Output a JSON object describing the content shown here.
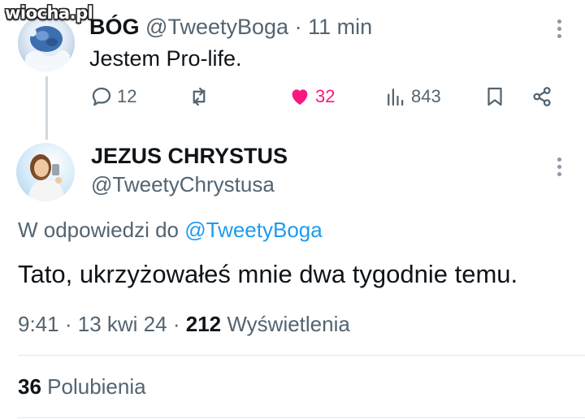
{
  "watermark": "wiocha.pl",
  "tweet1": {
    "name": "BÓG",
    "handle": "@TweetyBoga",
    "separator": "·",
    "time": "11 min",
    "text": "Jestem Pro-life.",
    "actions": {
      "replies": "12",
      "retweets": "",
      "likes": "32",
      "views": "843"
    },
    "liked": true,
    "like_color": "#f91880"
  },
  "tweet2": {
    "name": "JEZUS CHRYSTUS",
    "handle": "@TweetyChrystusa",
    "reply_prefix": "W odpowiedzi do",
    "reply_mention": "@TweetyBoga",
    "text": "Tato, ukrzyżowałeś mnie dwa tygodnie temu.",
    "time": "9:41",
    "date": "13 kwi 24",
    "separator": "·",
    "views_count": "212",
    "views_label": "Wyświetlenia",
    "likes_count": "36",
    "likes_label": "Polubienia"
  },
  "colors": {
    "text_primary": "#0f1419",
    "text_secondary": "#536471",
    "link": "#1d9bf0",
    "like": "#f91880"
  }
}
